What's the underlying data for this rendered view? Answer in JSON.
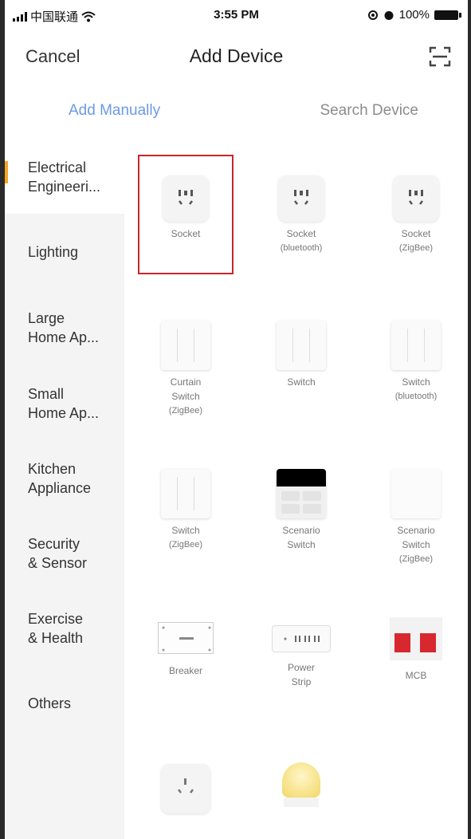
{
  "status_bar": {
    "carrier": "中国联通",
    "time": "3:55 PM",
    "battery": "100%"
  },
  "nav": {
    "cancel_label": "Cancel",
    "title": "Add Device"
  },
  "tabs": {
    "manual": "Add Manually",
    "search": "Search Device"
  },
  "sidebar": {
    "items": [
      {
        "line1": "Electrical",
        "line2": "Engineeri..."
      },
      {
        "line1": "Lighting",
        "line2": ""
      },
      {
        "line1": "Large",
        "line2": "Home Ap..."
      },
      {
        "line1": "Small",
        "line2": "Home Ap..."
      },
      {
        "line1": "Kitchen",
        "line2": "Appliance"
      },
      {
        "line1": "Security",
        "line2": "& Sensor"
      },
      {
        "line1": "Exercise",
        "line2": "& Health"
      },
      {
        "line1": "Others",
        "line2": ""
      }
    ]
  },
  "devices": [
    {
      "name": "Socket",
      "sub": "",
      "sub2": ""
    },
    {
      "name": "Socket",
      "sub": "(bluetooth)",
      "sub2": ""
    },
    {
      "name": "Socket",
      "sub": "(ZigBee)",
      "sub2": ""
    },
    {
      "name": "Curtain",
      "sub": "Switch",
      "sub2": "(ZigBee)"
    },
    {
      "name": "Switch",
      "sub": "",
      "sub2": ""
    },
    {
      "name": "Switch",
      "sub": "(bluetooth)",
      "sub2": ""
    },
    {
      "name": "Switch",
      "sub": "(ZigBee)",
      "sub2": ""
    },
    {
      "name": "Scenario",
      "sub": "Switch",
      "sub2": ""
    },
    {
      "name": "Scenario",
      "sub": "Switch",
      "sub2": "(ZigBee)"
    },
    {
      "name": "Breaker",
      "sub": "",
      "sub2": ""
    },
    {
      "name": "Power",
      "sub": "Strip",
      "sub2": ""
    },
    {
      "name": "MCB",
      "sub": "",
      "sub2": ""
    }
  ],
  "colors": {
    "accent": "#6b9be6",
    "highlight": "#c8262b",
    "sidebar_indicator": "#f5a623"
  }
}
